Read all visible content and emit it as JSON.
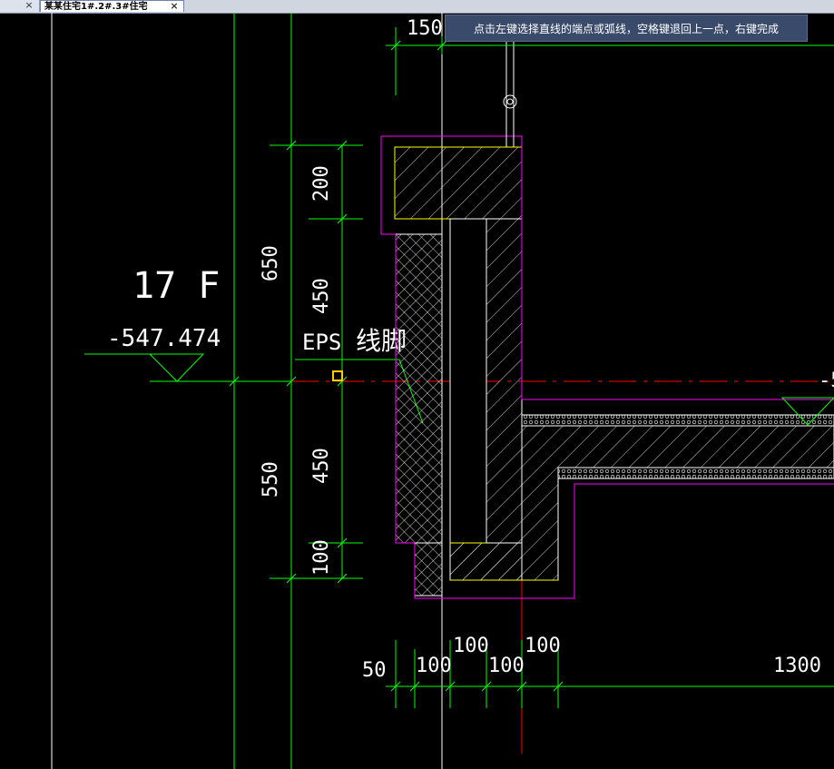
{
  "tabs": [
    {
      "label": "",
      "close": "×"
    },
    {
      "label": "某某住宅1#.2#.3#住宅",
      "close": "×"
    }
  ],
  "tooltip": "点击左键选择直线的端点或弧线，空格键退回上一点，右键完成",
  "drawing": {
    "floor_label": "17 F",
    "elevation": "-547.474",
    "eps_label": "EPS",
    "skirting_label": "线脚",
    "right_marker": "-5",
    "dims_vertical": {
      "d650": "650",
      "d550": "550",
      "d200": "200",
      "d450_top": "450",
      "d450_bottom": "450",
      "d100": "100"
    },
    "dims_horizontal": {
      "d150": "150",
      "d50": "50",
      "d100_a": "100",
      "d100_b": "100",
      "d100_c": "100",
      "d100_d": "100",
      "d1300": "1300"
    },
    "colors": {
      "background": "#000000",
      "dim_line": "#00ff00",
      "outline_magenta": "#ff00ff",
      "outline_yellow": "#ffff00",
      "axis_red": "#ff0000",
      "hatch_white": "#ffffff",
      "text_white": "#ffffff"
    }
  }
}
